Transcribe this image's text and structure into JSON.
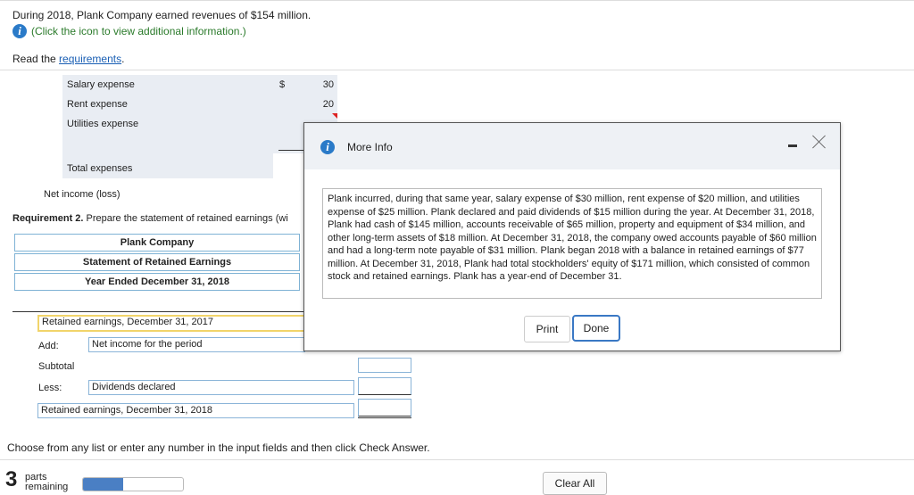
{
  "question": {
    "intro": "During 2018, Plank Company earned revenues of $154 million.",
    "info_link": "(Click the icon to view additional information.)",
    "read_prefix": "Read the ",
    "requirements_link": "requirements",
    "read_suffix": "."
  },
  "expenses": {
    "salary_label": "Salary expense",
    "rent_label": "Rent expense",
    "utilities_label": "Utilities expense",
    "dollar_sign": "$",
    "salary_value": "30",
    "rent_value": "20",
    "total_label": "Total expenses",
    "net_income_label": "Net income (loss)"
  },
  "requirement": {
    "bold": "Requirement 2.",
    "text": " Prepare the statement of retained earnings (wi"
  },
  "statement": {
    "company": "Plank Company",
    "title": "Statement of Retained Earnings",
    "period": "Year Ended December 31, 2018",
    "rows": {
      "beginning": "Retained earnings, December 31, 2017",
      "add_label": "Add:",
      "add_field": "Net income for the period",
      "subtotal": "Subtotal",
      "less_label": "Less:",
      "less_field": "Dividends declared",
      "ending": "Retained earnings, December 31, 2018"
    }
  },
  "footer": {
    "instruction": "Choose from any list or enter any number in the input fields and then click Check Answer.",
    "parts_number": "3",
    "parts_word": "parts",
    "remaining_word": "remaining",
    "progress_fraction": 0.4,
    "clear_all": "Clear All"
  },
  "modal": {
    "title": "More Info",
    "body": "Plank incurred, during that same year, salary expense of $30 million, rent expense of $20 million, and utilities expense of $25 million. Plank declared and paid dividends of $15 million during the year. At December 31, 2018, Plank had cash of $145 million, accounts receivable of $65 million, property and equipment of $34 million, and other long-term assets of $18 million. At December 31, 2018, the company owed accounts payable of $60 million and had a long-term note payable of $31 million. Plank began 2018 with a balance in retained earnings of $77 million. At December 31, 2018, Plank had total stockholders' equity of $171 million, which consisted of common stock and retained earnings. Plank has a year-end of December 31.",
    "print": "Print",
    "done": "Done"
  },
  "colors": {
    "accent_blue": "#2a7ac8",
    "link_green": "#2a7a2a",
    "panel_bg": "#e9edf3"
  },
  "icons": {
    "info": "info-circle-icon",
    "close": "close-icon",
    "minimize": "minimize-icon"
  }
}
